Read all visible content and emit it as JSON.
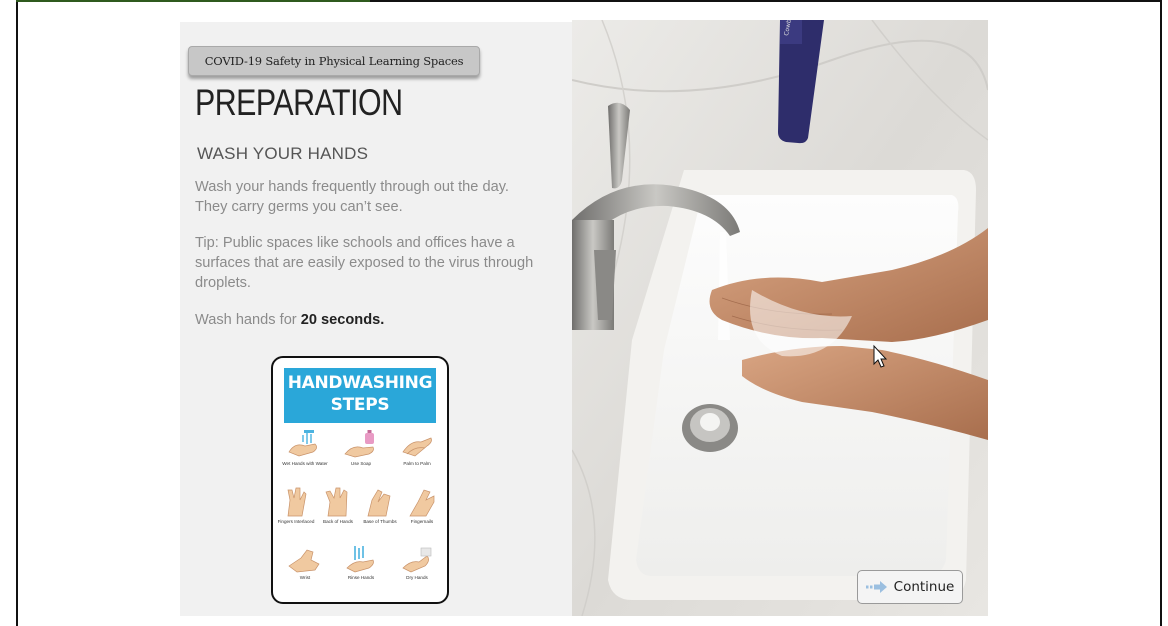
{
  "course": {
    "tag": "COVID-19 Safety in Physical Learning Spaces"
  },
  "slide": {
    "title": "PREPARATION",
    "subtitle": "WASH YOUR HANDS",
    "paragraph1": "Wash your hands frequently through out the day. They carry germs you can’t see.",
    "paragraph2": "Tip: Public spaces like schools and offices have a surfaces that are easily exposed to the virus through droplets.",
    "paragraph3_prefix": "Wash hands for ",
    "paragraph3_bold": "20 seconds."
  },
  "poster": {
    "title_line1": "HANDWASHING",
    "title_line2": "STEPS",
    "steps": [
      "Wet Hands with Water",
      "Use Soap",
      "Palm to Palm",
      "Fingers Interlaced",
      "Back of Hands",
      "Base of Thumbs",
      "Fingernails",
      "Wrist",
      "Rinse Hands",
      "Dry Hands"
    ]
  },
  "nav": {
    "continue_label": "Continue",
    "continue_icon": "arrow-right-icon"
  },
  "photo": {
    "bottle_label": "Cowboy"
  },
  "colors": {
    "poster_header": "#2aa7d9",
    "course_tag_bg": "#c7c7c7",
    "title_text": "#222222"
  }
}
